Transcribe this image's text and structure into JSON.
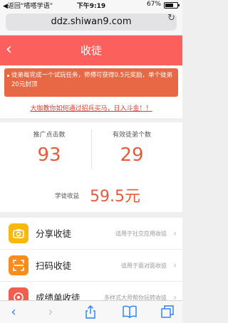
{
  "status_bar": {
    "back_text": "◀返回“嗒嗒学语”",
    "time": "下午9:19",
    "battery_text": "67%",
    "battery_level": 0.67
  },
  "browser": {
    "url": "ddz.shiwan9.com"
  },
  "header": {
    "back_symbol": "‹",
    "title": "收徒"
  },
  "notice": {
    "text": "徒弟每完成一个试玩任务，师傅可获得0.5元奖励，单个徒弟20元封顶",
    "tip_link": "大咖教你如何通过招兵买马，日入斗金！！"
  },
  "stats": {
    "clicks_label": "推广点击数",
    "clicks_value": "93",
    "apprentices_label": "有效徒弟个数",
    "apprentices_value": "29",
    "earnings_label": "学徒收益",
    "earnings_value": "59.5元"
  },
  "menu": {
    "items": [
      {
        "name": "分享收徒",
        "desc": "适用于社交应用收徒",
        "icon": "camera-icon",
        "color": "#f9b80e"
      },
      {
        "name": "扫码收徒",
        "desc": "适用于面对面收徒",
        "icon": "scan-icon",
        "color": "#fb8b1a"
      },
      {
        "name": "成绩单收徒",
        "desc": "多样式大师帮你玩转收徒",
        "icon": "record-icon",
        "color": "#f25d4d"
      }
    ],
    "chevron": "›"
  },
  "toolbar": {
    "back": "back-arrow-icon",
    "forward": "forward-arrow-icon",
    "share": "share-icon",
    "bookmarks": "book-icon",
    "tabs": "tabs-icon"
  },
  "colors": {
    "accent_red": "#fb605d",
    "value_orange": "#e65b3c",
    "ios_blue": "#2b7cf6"
  }
}
